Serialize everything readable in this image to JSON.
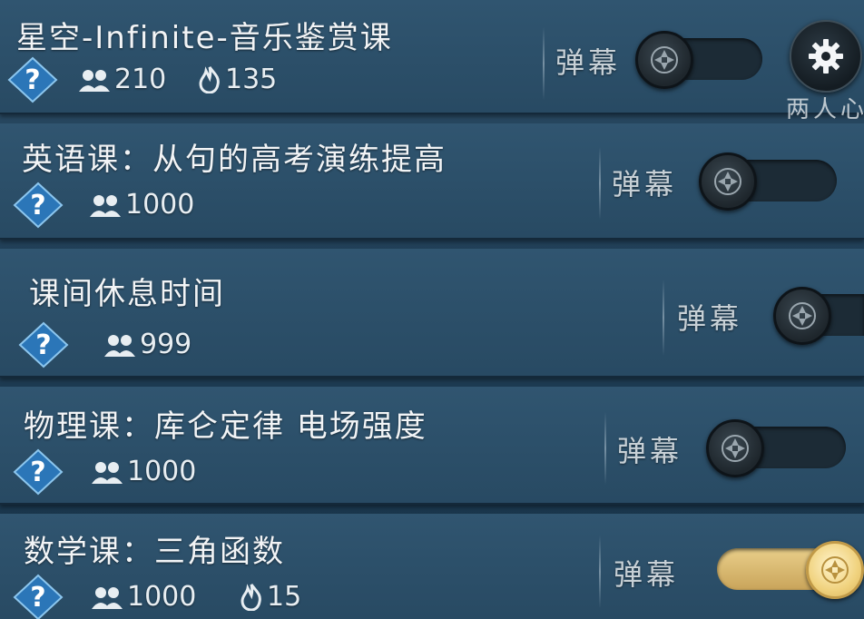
{
  "side": {
    "settings_icon": "gear-icon",
    "label": "两人心"
  },
  "rows": [
    {
      "title": "星空-Infinite-音乐鉴赏课",
      "viewers": "210",
      "heat": "135",
      "danmu_label": "弹幕",
      "danmu_on": false
    },
    {
      "title": "英语课：从句的高考演练提高",
      "viewers": "1000",
      "danmu_label": "弹幕",
      "danmu_on": false
    },
    {
      "title": "课间休息时间",
      "viewers": "999",
      "danmu_label": "弹幕",
      "danmu_on": false
    },
    {
      "title": "物理课：库仑定律 电场强度",
      "viewers": "1000",
      "danmu_label": "弹幕",
      "danmu_on": false
    },
    {
      "title": "数学课：三角函数",
      "viewers": "1000",
      "heat": "15",
      "danmu_label": "弹幕",
      "danmu_on": true
    }
  ],
  "colors": {
    "row_bg": "#2c4f69",
    "toggle_off": "#1c2b36",
    "toggle_on": "#d8b86a"
  }
}
